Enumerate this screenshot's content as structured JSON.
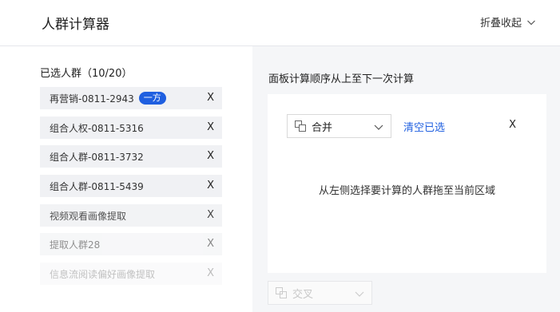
{
  "header": {
    "title": "人群计算器",
    "collapse_label": "折叠收起"
  },
  "left": {
    "title": "已选人群（10/20）",
    "items": [
      {
        "label": "再营销-0811-2943",
        "badge": "一方",
        "remove": "X"
      },
      {
        "label": "组合人权-0811-5316",
        "remove": "X"
      },
      {
        "label": "组合人群-0811-3732",
        "remove": "X"
      },
      {
        "label": "组合人群-0811-5439",
        "remove": "X"
      },
      {
        "label": "视频观看画像提取",
        "remove": "X"
      },
      {
        "label": "提取人群28",
        "remove": "X"
      },
      {
        "label": "信息流阅读偏好画像提取",
        "remove": "X"
      }
    ]
  },
  "right": {
    "title": "面板计算顺序从上至下一次计算",
    "panel": {
      "operator": "合并",
      "clear_label": "清空已选",
      "close_label": "X",
      "hint": "从左侧选择要计算的人群拖至当前区域"
    },
    "next_operator": "交叉"
  },
  "colors": {
    "accent": "#1f5fe0",
    "item_bg": "#f0f1f4",
    "right_bg": "#f5f6f8"
  }
}
